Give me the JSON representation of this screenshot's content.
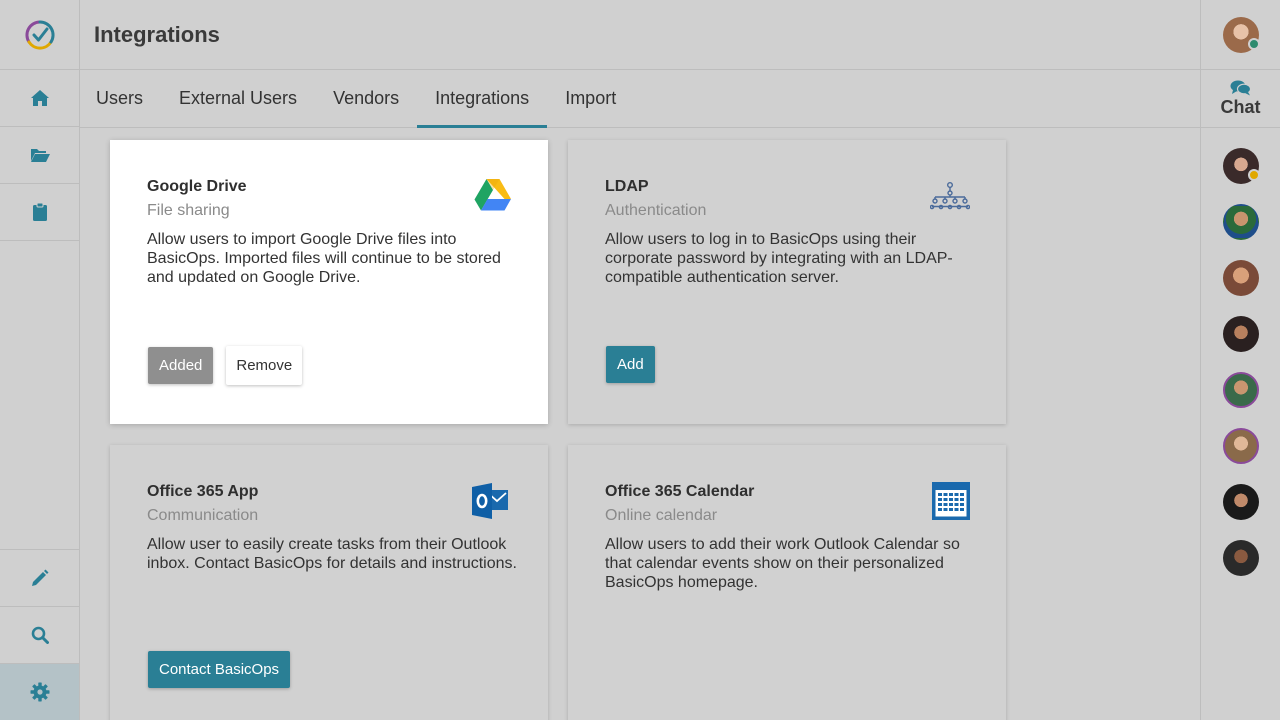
{
  "header": {
    "title": "Integrations"
  },
  "tabs": [
    {
      "label": "Users"
    },
    {
      "label": "External Users"
    },
    {
      "label": "Vendors"
    },
    {
      "label": "Integrations",
      "active": true
    },
    {
      "label": "Import"
    }
  ],
  "left_nav": {
    "items": [
      "home-icon",
      "folder-open-icon",
      "clipboard-icon"
    ],
    "bottom_items": [
      "pencil-icon",
      "search-icon",
      "gear-icon"
    ]
  },
  "chat": {
    "label": "Chat"
  },
  "colors": {
    "accent": "#2a7f95",
    "status_online": "#2e8b6e",
    "status_away": "#e0a800"
  },
  "cards": [
    {
      "title": "Google Drive",
      "subtitle": "File sharing",
      "description": "Allow users to import Google Drive files into BasicOps. Imported files will continue to be stored and updated on Google Drive.",
      "icon": "google-drive-icon",
      "buttons": {
        "added": "Added",
        "remove": "Remove"
      }
    },
    {
      "title": "LDAP",
      "subtitle": "Authentication",
      "description": "Allow users to log in to BasicOps using their corporate password by integrating with an LDAP-compatible authentication server.",
      "icon": "hierarchy-icon",
      "buttons": {
        "add": "Add"
      }
    },
    {
      "title": "Office 365 App",
      "subtitle": "Communication",
      "description": "Allow user to easily create tasks from their Outlook inbox. Contact BasicOps for details and instructions.",
      "icon": "outlook-icon",
      "buttons": {
        "contact": "Contact BasicOps"
      }
    },
    {
      "title": "Office 365 Calendar",
      "subtitle": "Online calendar",
      "description": "Allow users to add their work Outlook Calendar so that calendar events show on their personalized BasicOps homepage.",
      "icon": "calendar-icon",
      "buttons": {}
    }
  ]
}
